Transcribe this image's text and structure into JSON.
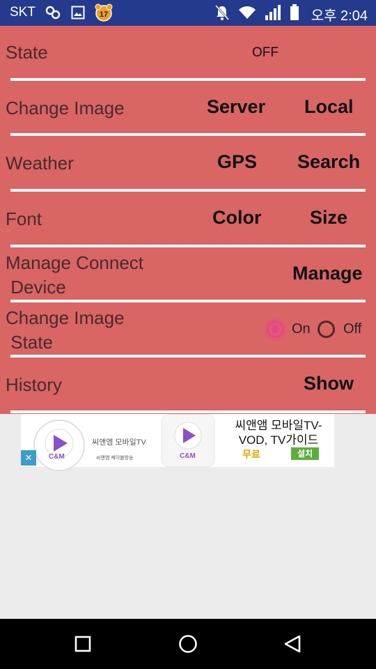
{
  "status_bar": {
    "carrier": "SKT",
    "time": "오후 2:04",
    "icons": [
      "link-icon",
      "image-icon",
      "app-badge-icon",
      "mute-icon",
      "wifi-icon",
      "signal-icon",
      "battery-icon"
    ],
    "badge_number": "17"
  },
  "colors": {
    "panel": "#d96565",
    "status_bar": "#243a8c",
    "accent": "#e8458a"
  },
  "settings": {
    "state": {
      "label": "State",
      "value": "OFF"
    },
    "change_image": {
      "label": "Change Image",
      "server": "Server",
      "local": "Local"
    },
    "weather": {
      "label": "Weather",
      "gps": "GPS",
      "search": "Search"
    },
    "font": {
      "label": "Font",
      "color": "Color",
      "size": "Size"
    },
    "manage_device": {
      "label": "Manage Connect\n Device",
      "manage": "Manage"
    },
    "change_image_state": {
      "label": "Change Image\n State",
      "on": "On",
      "off": "Off",
      "selected": "On"
    },
    "history": {
      "label": "History",
      "show": "Show"
    }
  },
  "ad": {
    "brand_small": "씨앤엠 모바일TV",
    "brand_tag": "씨앤엠 케이블방송",
    "logo_text": "C&M",
    "title": "씨앤앰 모바일TV-VOD, TV가이드",
    "free_label": "무료",
    "install_label": "설치",
    "close": "×"
  },
  "nav": {
    "icons": [
      "recent-apps-icon",
      "home-icon",
      "back-icon"
    ]
  }
}
